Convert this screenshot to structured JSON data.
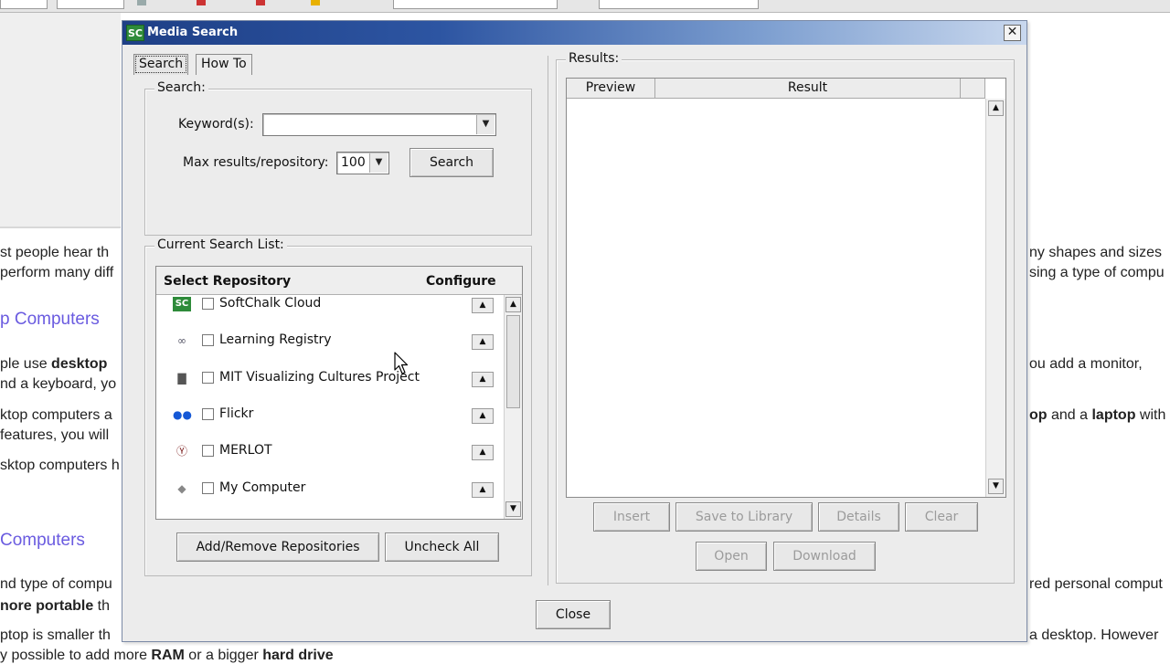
{
  "background": {
    "lines": [
      {
        "pre": "st people hear th",
        "bold": "",
        "post": ""
      },
      {
        "pre": "perform many diff",
        "bold": "",
        "post": ""
      },
      {
        "pre": "ple use ",
        "bold": "desktop",
        "post": ""
      },
      {
        "pre": "nd a keyboard, yo",
        "bold": "",
        "post": ""
      },
      {
        "pre": "ktop computers a",
        "bold": "",
        "post": ""
      },
      {
        "pre": "features, you will",
        "bold": "",
        "post": ""
      },
      {
        "pre": "sktop computers h",
        "bold": "",
        "post": ""
      },
      {
        "pre": "nd type of compu",
        "bold": "",
        "post": ""
      },
      {
        "pre": "",
        "bold": "nore portable",
        "post": " th"
      },
      {
        "pre": "ptop is smaller th",
        "bold": "",
        "post": ""
      },
      {
        "pre": "y possible to add more ",
        "bold": "RAM",
        "post": " or a bigger "
      }
    ],
    "right_lines": [
      {
        "pre": "ny shapes and sizes",
        "bold": "",
        "post": ""
      },
      {
        "pre": "sing a type of compu",
        "bold": "",
        "post": ""
      },
      {
        "pre": "ou add a monitor,",
        "bold": "",
        "post": ""
      },
      {
        "pre": "",
        "bold": "op",
        "post": " and a "
      },
      {
        "pre": "red personal comput",
        "bold": "",
        "post": ""
      },
      {
        "pre": "a desktop. However",
        "bold": "",
        "post": ""
      }
    ],
    "right_bold2": "laptop",
    "right_post2": " with",
    "bottom_bold": "hard drive",
    "headings": [
      "p Computers",
      "Computers"
    ]
  },
  "dialog": {
    "title": "Media Search",
    "logo": "SC",
    "close_glyph": "✕",
    "tabs": [
      "Search",
      "How To"
    ],
    "search_group": {
      "legend": "Search:",
      "keyword_label": "Keyword(s):",
      "keyword_value": "",
      "max_label": "Max results/repository:",
      "max_value": "100",
      "search_button": "Search"
    },
    "list_group": {
      "legend": "Current Search List:",
      "col_repo": "Select Repository",
      "col_config": "Configure",
      "repositories": [
        {
          "name": "SoftChalk Cloud",
          "icon": "softchalk-icon",
          "glyph": "SC",
          "color": "#2e8b3a"
        },
        {
          "name": "Learning Registry",
          "icon": "learning-registry-icon",
          "glyph": "∞",
          "color": "#556"
        },
        {
          "name": "MIT Visualizing Cultures Project",
          "icon": "mit-visualizing-cultures-icon",
          "glyph": "▇",
          "color": "#555"
        },
        {
          "name": "Flickr",
          "icon": "flickr-icon",
          "glyph": "●●",
          "color": "#1558d6"
        },
        {
          "name": "MERLOT",
          "icon": "merlot-icon",
          "glyph": "Ⓨ",
          "color": "#7a1a1a"
        },
        {
          "name": "My Computer",
          "icon": "my-computer-icon",
          "glyph": "◆",
          "color": "#888"
        }
      ],
      "add_remove_button": "Add/Remove Repositories",
      "uncheck_button": "Uncheck All"
    },
    "results_group": {
      "legend": "Results:",
      "col_preview": "Preview",
      "col_result": "Result",
      "buttons_row1": [
        "Insert",
        "Save to Library",
        "Details",
        "Clear"
      ],
      "buttons_row2": [
        "Open",
        "Download"
      ]
    },
    "close_button": "Close"
  }
}
